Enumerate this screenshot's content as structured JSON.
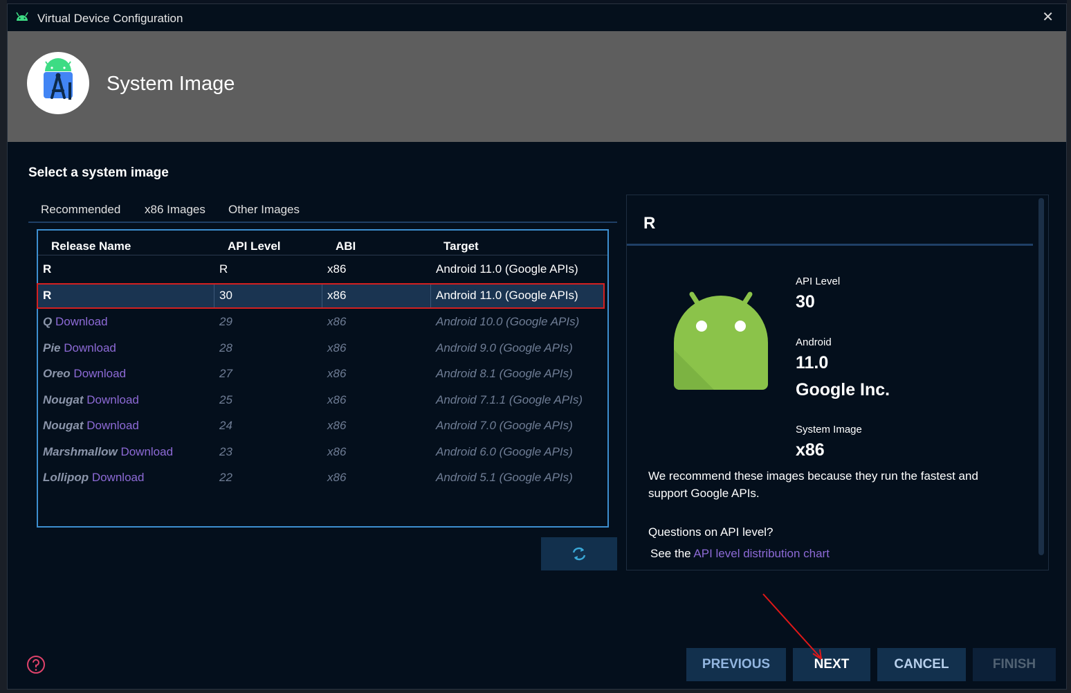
{
  "window": {
    "title": "Virtual Device Configuration",
    "close_glyph": "✕"
  },
  "header": {
    "title": "System Image",
    "logo": "android-studio-logo"
  },
  "section_title": "Select a system image",
  "tabs": [
    {
      "label": "Recommended",
      "active": true
    },
    {
      "label": "x86 Images",
      "active": false
    },
    {
      "label": "Other Images",
      "active": false
    }
  ],
  "table": {
    "columns": [
      "Release Name",
      "API Level",
      "ABI",
      "Target"
    ],
    "rows": [
      {
        "release": "R",
        "download": "",
        "api": "R",
        "abi": "x86",
        "target": "Android 11.0 (Google APIs)",
        "state": "installed"
      },
      {
        "release": "R",
        "download": "",
        "api": "30",
        "abi": "x86",
        "target": "Android 11.0 (Google APIs)",
        "state": "selected"
      },
      {
        "release": "Q",
        "download": "Download",
        "api": "29",
        "abi": "x86",
        "target": "Android 10.0 (Google APIs)",
        "state": "available"
      },
      {
        "release": "Pie",
        "download": "Download",
        "api": "28",
        "abi": "x86",
        "target": "Android 9.0 (Google APIs)",
        "state": "available"
      },
      {
        "release": "Oreo",
        "download": "Download",
        "api": "27",
        "abi": "x86",
        "target": "Android 8.1 (Google APIs)",
        "state": "available"
      },
      {
        "release": "Nougat",
        "download": "Download",
        "api": "25",
        "abi": "x86",
        "target": "Android 7.1.1 (Google APIs)",
        "state": "available"
      },
      {
        "release": "Nougat",
        "download": "Download",
        "api": "24",
        "abi": "x86",
        "target": "Android 7.0 (Google APIs)",
        "state": "available"
      },
      {
        "release": "Marshmallow",
        "download": "Download",
        "api": "23",
        "abi": "x86",
        "target": "Android 6.0 (Google APIs)",
        "state": "available"
      },
      {
        "release": "Lollipop",
        "download": "Download",
        "api": "22",
        "abi": "x86",
        "target": "Android 5.1 (Google APIs)",
        "state": "available"
      }
    ]
  },
  "details": {
    "title": "R",
    "api_level_label": "API Level",
    "api_level_value": "30",
    "android_label": "Android",
    "android_version": "11.0",
    "vendor": "Google Inc.",
    "system_image_label": "System Image",
    "system_image_value": "x86",
    "recommend_text": "We recommend these images because they run the fastest and support Google APIs.",
    "question": "Questions on API level?",
    "see_the": "See the ",
    "link_text": "API level distribution chart"
  },
  "buttons": {
    "previous": "PREVIOUS",
    "next": "NEXT",
    "cancel": "CANCEL",
    "finish": "FINISH"
  },
  "colors": {
    "background": "#040f1c",
    "header": "#5e5e5e",
    "selection_border": "#d42020",
    "link": "#8d6ad6",
    "button": "#12304d",
    "android_green": "#8bc34a"
  }
}
